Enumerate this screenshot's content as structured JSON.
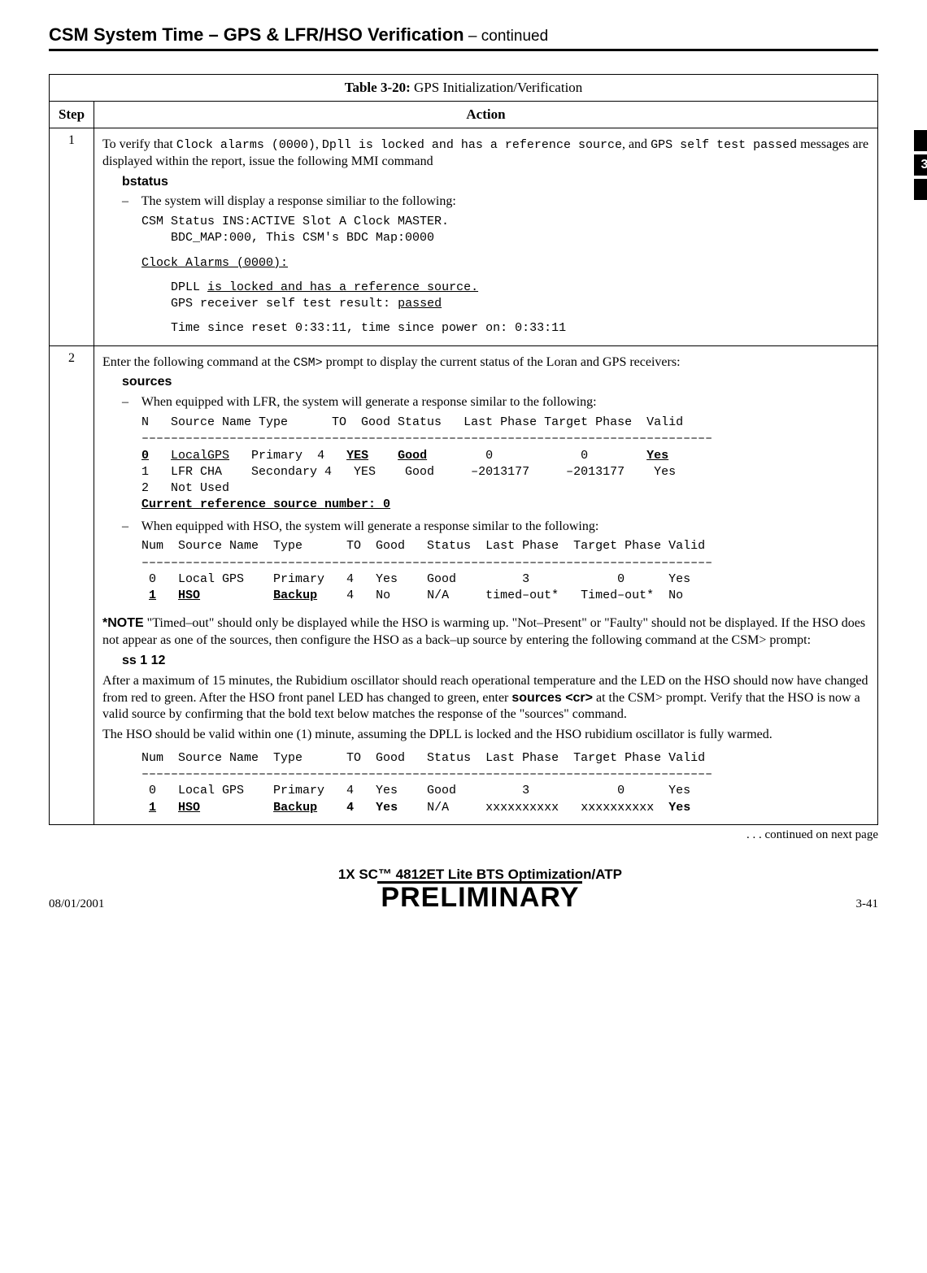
{
  "page_title_main": "CSM System Time – GPS & LFR/HSO Verification",
  "page_title_cont": " – continued",
  "side_tab": "3",
  "table": {
    "num": "Table 3-20:",
    "title": " GPS Initialization/Verification",
    "hdr_step": "Step",
    "hdr_action": "Action"
  },
  "step1": {
    "num": "1",
    "intro_a": "To verify that ",
    "intro_code1": "Clock alarms (0000)",
    "intro_b": ", ",
    "intro_code2": "Dpll is locked and has a reference source",
    "intro_c": ", and ",
    "intro_code3": "GPS self test passed",
    "intro_d": " messages are displayed within the report, issue the following MMI command",
    "cmd": "bstatus",
    "dash": "–",
    "bullet1": "  The system will display a response similiar to the following:",
    "l1": "CSM Status INS:ACTIVE Slot A Clock MASTER.",
    "l2": "    BDC_MAP:000, This CSM's BDC Map:0000",
    "l3u": "Clock Alarms (0000):",
    "l4a": "    DPLL ",
    "l4u": "is locked and has a reference source.",
    "l5a": "    GPS receiver self test result: ",
    "l5u": "passed",
    "l6": "    Time since reset 0:33:11, time since power on: 0:33:11"
  },
  "step2": {
    "num": "2",
    "intro_a": "Enter the following command at the ",
    "intro_code": "CSM>",
    "intro_b": " prompt to display the current status of the Loran and GPS receivers:",
    "cmd": "sources",
    "dash": "–",
    "bullet1": "  When equipped with LFR, the system will generate a response similar to the following:",
    "t1_hdr": "N   Source Name Type      TO  Good Status   Last Phase Target Phase  Valid",
    "t1_rule": "––––––––––––––––––––––––––––––––––––––––––––––––––––––––––––––––––––––––––––––",
    "t1_r0a": "0",
    "t1_r0b": "   ",
    "t1_r0c": "LocalGPS",
    "t1_r0d": "   Primary  4   ",
    "t1_r0e": "YES",
    "t1_r0f": "    ",
    "t1_r0g": "Good",
    "t1_r0h": "        0            0        ",
    "t1_r0i": "Yes",
    "t1_r1": "1   LFR CHA    Secondary 4   YES    Good     –2013177     –2013177    Yes",
    "t1_r2": "2   Not Used",
    "t1_cur": "Current reference source number: 0",
    "bullet2": "  When equipped with HSO, the system will generate a response similar to the following:",
    "t2_hdr": "Num  Source Name  Type      TO  Good   Status  Last Phase  Target Phase Valid",
    "t2_rule": "––––––––––––––––––––––––––––––––––––––––––––––––––––––––––––––––––––––––––––––",
    "t2_r0": " 0   Local GPS    Primary   4   Yes    Good         3            0      Yes",
    "t2_r1a": " ",
    "t2_r1b": "1",
    "t2_r1c": "   ",
    "t2_r1d": "HSO",
    "t2_r1e": "          ",
    "t2_r1f": "Backup",
    "t2_r1g": "    4   No     N/A     timed–out*   Timed–out*  No",
    "note_label": "*NOTE",
    "note_body": " \"Timed–out\" should only be displayed while the HSO is warming up. \"Not–Present\" or \"Faulty\" should not be displayed. If the HSO does not appear as one of the sources, then configure the HSO as a back–up source by entering the following command at the CSM> prompt:",
    "ss_cmd": "ss  1  12",
    "after_a": "After a maximum of 15 minutes, the Rubidium oscillator should reach operational temperature and the LED on the HSO should now have changed from red to green. After the HSO front panel LED has changed to green, enter ",
    "after_b": "sources <cr>",
    "after_c": " at the CSM> prompt. Verify that the HSO is now a valid source by confirming that the bold text below matches the response of the \"sources\" command.",
    "valid_line": "The HSO should be valid within one (1) minute, assuming the DPLL is locked and the HSO rubidium oscillator is fully warmed.",
    "t3_hdr": "Num  Source Name  Type      TO  Good   Status  Last Phase  Target Phase Valid",
    "t3_rule": "––––––––––––––––––––––––––––––––––––––––––––––––––––––––––––––––––––––––––––––",
    "t3_r0": " 0   Local GPS    Primary   4   Yes    Good         3            0      Yes",
    "t3_r1a": " ",
    "t3_r1b": "1",
    "t3_r1c": "   ",
    "t3_r1d": "HSO",
    "t3_r1e": "          ",
    "t3_r1f": "Backup",
    "t3_r1g": "    ",
    "t3_r1h": "4",
    "t3_r1i": "   ",
    "t3_r1j": "Yes",
    "t3_r1k": "    N/A     xxxxxxxxxx   xxxxxxxxxx  ",
    "t3_r1l": "Yes"
  },
  "continued": ". . . continued on next page",
  "footer": {
    "date": "08/01/2001",
    "center": "1X SC™ 4812ET Lite BTS Optimization/ATP",
    "prelim": "PRELIMINARY",
    "pagenum": "3-41"
  }
}
